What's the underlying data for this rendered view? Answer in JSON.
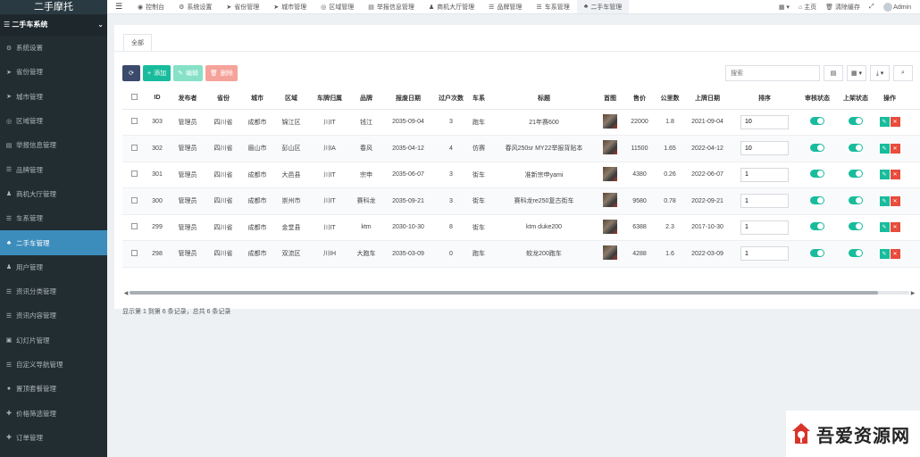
{
  "brand": "二手摩托",
  "sidebar": {
    "section": "二手车系统",
    "items": [
      {
        "label": "系统设置",
        "icon": "gears-icon",
        "glyph": "⚙",
        "active": false
      },
      {
        "label": "省份管理",
        "icon": "location-arrow-icon",
        "glyph": "➤",
        "active": false
      },
      {
        "label": "城市管理",
        "icon": "location-arrow-icon",
        "glyph": "➤",
        "active": false
      },
      {
        "label": "区域管理",
        "icon": "compass-icon",
        "glyph": "◎",
        "active": false
      },
      {
        "label": "举报信息管理",
        "icon": "film-icon",
        "glyph": "▤",
        "active": false
      },
      {
        "label": "品牌管理",
        "icon": "list-icon",
        "glyph": "☰",
        "active": false
      },
      {
        "label": "商机大厅管理",
        "icon": "user-icon",
        "glyph": "♟",
        "active": false
      },
      {
        "label": "车系管理",
        "icon": "list-icon",
        "glyph": "☰",
        "active": false
      },
      {
        "label": "二手车管理",
        "icon": "sitemap-icon",
        "glyph": "♣",
        "active": true
      },
      {
        "label": "用户管理",
        "icon": "user-icon",
        "glyph": "♟",
        "active": false
      },
      {
        "label": "资讯分类管理",
        "icon": "list-icon",
        "glyph": "☰",
        "active": false
      },
      {
        "label": "资讯内容管理",
        "icon": "list-icon",
        "glyph": "☰",
        "active": false
      },
      {
        "label": "幻灯片管理",
        "icon": "image-icon",
        "glyph": "▣",
        "active": false
      },
      {
        "label": "自定义导航管理",
        "icon": "list-icon",
        "glyph": "☰",
        "active": false
      },
      {
        "label": "置顶套餐管理",
        "icon": "circle-icon",
        "glyph": "●",
        "active": false
      },
      {
        "label": "价格筛选管理",
        "icon": "arrows-icon",
        "glyph": "✚",
        "active": false
      },
      {
        "label": "订单管理",
        "icon": "arrows-icon",
        "glyph": "✚",
        "active": false
      }
    ]
  },
  "topbar": {
    "tabs": [
      {
        "label": "控制台",
        "icon": "dashboard-icon",
        "glyph": "◉",
        "active": false
      },
      {
        "label": "系统设置",
        "icon": "gears-icon",
        "glyph": "⚙",
        "active": false
      },
      {
        "label": "省份管理",
        "icon": "location-arrow-icon",
        "glyph": "➤",
        "active": false
      },
      {
        "label": "城市管理",
        "icon": "location-arrow-icon",
        "glyph": "➤",
        "active": false
      },
      {
        "label": "区域管理",
        "icon": "compass-icon",
        "glyph": "◎",
        "active": false
      },
      {
        "label": "举报信息管理",
        "icon": "film-icon",
        "glyph": "▤",
        "active": false
      },
      {
        "label": "商机大厅管理",
        "icon": "user-icon",
        "glyph": "♟",
        "active": false
      },
      {
        "label": "品牌管理",
        "icon": "list-icon",
        "glyph": "☰",
        "active": false
      },
      {
        "label": "车系管理",
        "icon": "list-icon",
        "glyph": "☰",
        "active": false
      },
      {
        "label": "二手车管理",
        "icon": "sitemap-icon",
        "glyph": "♣",
        "active": true
      }
    ],
    "home": "主页",
    "clear_cache": "清除缓存",
    "user": "Admin"
  },
  "panel": {
    "tab_all": "全部",
    "buttons": {
      "add": "添加",
      "edit": "编辑",
      "delete": "删除"
    },
    "search_placeholder": "搜索"
  },
  "table": {
    "columns": [
      "ID",
      "发布者",
      "省份",
      "城市",
      "区域",
      "车牌归属",
      "品牌",
      "报废日期",
      "过户次数",
      "车系",
      "标题",
      "首图",
      "售价",
      "公里数",
      "上牌日期",
      "排序",
      "审核状态",
      "上架状态",
      "操作"
    ],
    "rows": [
      {
        "id": "303",
        "publisher": "管理员",
        "province": "四川省",
        "city": "成都市",
        "area": "锦江区",
        "plate": "川IT",
        "brand": "钱江",
        "scrap_date": "2035-09-04",
        "transfers": "3",
        "series": "跑车",
        "title": "21年赛600",
        "price": "22000",
        "km": "1.8",
        "reg_date": "2021-09-04",
        "sort": "10",
        "audit": true,
        "shelf": true
      },
      {
        "id": "302",
        "publisher": "管理员",
        "province": "四川省",
        "city": "眉山市",
        "area": "彭山区",
        "plate": "川IA",
        "brand": "春风",
        "scrap_date": "2035-04-12",
        "transfers": "4",
        "series": "仿赛",
        "title": "春风250sr MY22举报背贴本",
        "price": "11500",
        "km": "1.65",
        "reg_date": "2022-04-12",
        "sort": "10",
        "audit": true,
        "shelf": true
      },
      {
        "id": "301",
        "publisher": "管理员",
        "province": "四川省",
        "city": "成都市",
        "area": "大邑县",
        "plate": "川IT",
        "brand": "宗申",
        "scrap_date": "2035-06-07",
        "transfers": "3",
        "series": "街车",
        "title": "准新宗申yami",
        "price": "4380",
        "km": "0.26",
        "reg_date": "2022-06-07",
        "sort": "1",
        "audit": true,
        "shelf": true
      },
      {
        "id": "300",
        "publisher": "管理员",
        "province": "四川省",
        "city": "成都市",
        "area": "崇州市",
        "plate": "川IT",
        "brand": "赛科龙",
        "scrap_date": "2035-09-21",
        "transfers": "3",
        "series": "街车",
        "title": "赛科龙re250复古街车",
        "price": "9580",
        "km": "0.78",
        "reg_date": "2022-09-21",
        "sort": "1",
        "audit": true,
        "shelf": true
      },
      {
        "id": "299",
        "publisher": "管理员",
        "province": "四川省",
        "city": "成都市",
        "area": "金堂县",
        "plate": "川IT",
        "brand": "ktm",
        "scrap_date": "2030-10-30",
        "transfers": "8",
        "series": "街车",
        "title": "ktm duke200",
        "price": "6388",
        "km": "2.3",
        "reg_date": "2017-10-30",
        "sort": "1",
        "audit": true,
        "shelf": true
      },
      {
        "id": "298",
        "publisher": "管理员",
        "province": "四川省",
        "city": "成都市",
        "area": "双流区",
        "plate": "川IH",
        "brand": "大跑车",
        "scrap_date": "2035-03-09",
        "transfers": "0",
        "series": "跑车",
        "title": "蛟龙200跑车",
        "price": "4288",
        "km": "1.6",
        "reg_date": "2022-03-09",
        "sort": "1",
        "audit": true,
        "shelf": true
      }
    ]
  },
  "scroll_fraction": 0.96,
  "footer": "显示第 1 到第 6 条记录，总共 6 条记录",
  "watermark": "吾爱资源网",
  "colors": {
    "sidebar": "#222d32",
    "active": "#3c8dbc",
    "primary": "#18bc9c",
    "danger": "#e74c3c"
  }
}
